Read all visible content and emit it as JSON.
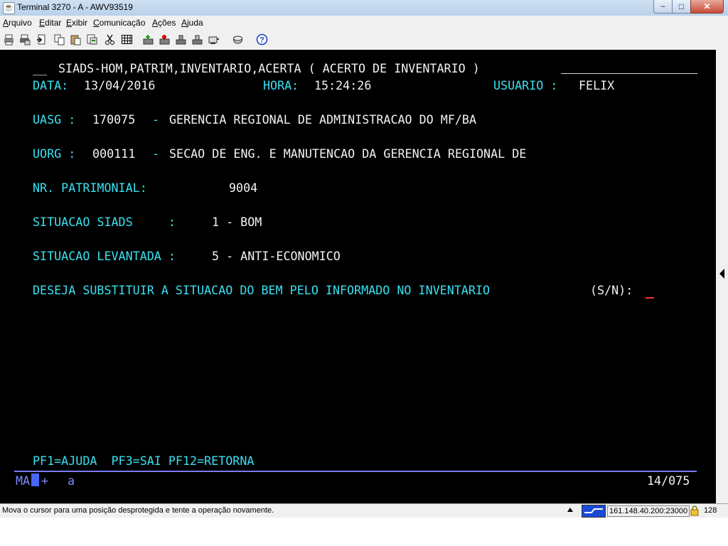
{
  "window": {
    "title": "Terminal 3270 - A - AWV93519",
    "minimize": "−",
    "maximize": "□",
    "close": "✕"
  },
  "menu": [
    "Arquivo",
    "Editar",
    "Exibir",
    "Comunicação",
    "Ações",
    "Ajuda"
  ],
  "toolbar_icons": [
    "print-screen-icon",
    "print-setup-icon",
    "page-setup-icon",
    "copy-icon",
    "paste-icon",
    "copy-append-icon",
    "cut-icon",
    "grid-icon",
    "connect-icon",
    "disconnect-icon",
    "sessions-icon",
    "keyboard-icon",
    "macro-icon",
    "help-icon"
  ],
  "terminal": {
    "header_lead": "__",
    "header": "SIADS-HOM,PATRIM,INVENTARIO,ACERTA ( ACERTO DE INVENTARIO )",
    "data_label": "DATA:",
    "data_value": "13/04/2016",
    "hora_label": "HORA:",
    "hora_value": "15:24:26",
    "usuario_label": "USUARIO :",
    "usuario_value": "FELIX",
    "uasg_label": "UASG :",
    "uasg_code": "170075",
    "uasg_dash": "-",
    "uasg_name": "GERENCIA REGIONAL DE ADMINISTRACAO DO MF/BA",
    "uorg_label": "UORG :",
    "uorg_code": "000111",
    "uorg_dash": "-",
    "uorg_name": "SECAO DE ENG. E MANUTENCAO DA GERENCIA REGIONAL DE",
    "patrimonial_label": "NR. PATRIMONIAL:",
    "patrimonial_value": "9004",
    "sit_siads_label": "SITUACAO SIADS     :",
    "sit_siads_value": "1 - BOM",
    "sit_lev_label": "SITUACAO LEVANTADA :",
    "sit_lev_value": "5 - ANTI-ECONOMICO",
    "question": "DESEJA SUBSTITUIR A SITUACAO DO BEM PELO INFORMADO NO INVENTARIO",
    "question_options": "(S/N):",
    "function_keys": "PF1=AJUDA  PF3=SAI PF12=RETORNA",
    "oia_left": "MA",
    "oia_plus": "+",
    "oia_mode": "a",
    "cursor_pos": "14/075"
  },
  "statusbar": {
    "message": "Mova o cursor para uma posição desprotegida e tente a operação novamente.",
    "host": "161.148.40.200:23000",
    "encryption": "128"
  },
  "colors": {
    "terminal_bg": "#000000",
    "field_label": "#39e0f0",
    "field_value": "#f2f2f2",
    "cursor": "#ff3030",
    "divider": "#7a7aff"
  }
}
